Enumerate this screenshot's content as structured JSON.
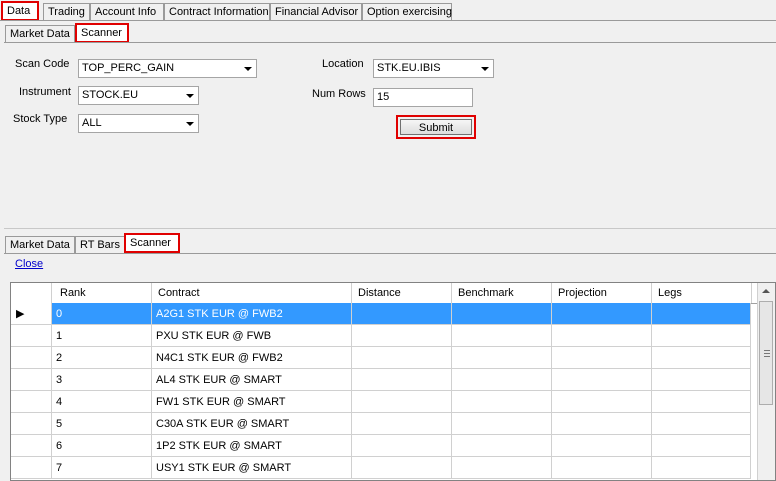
{
  "top_tabs": [
    "Data",
    "Trading",
    "Account Info",
    "Contract Information",
    "Financial Advisor",
    "Option exercising"
  ],
  "sub_tabs": [
    "Market Data",
    "Scanner"
  ],
  "form": {
    "scan_code_label": "Scan Code",
    "scan_code_value": "TOP_PERC_GAIN",
    "instrument_label": "Instrument",
    "instrument_value": "STOCK.EU",
    "stock_type_label": "Stock Type",
    "stock_type_value": "ALL",
    "location_label": "Location",
    "location_value": "STK.EU.IBIS",
    "num_rows_label": "Num Rows",
    "num_rows_value": "15",
    "submit_label": "Submit"
  },
  "result_tabs": [
    "Market Data",
    "RT Bars",
    "Scanner"
  ],
  "close_label": "Close",
  "grid": {
    "columns": [
      "Rank",
      "Contract",
      "Distance",
      "Benchmark",
      "Projection",
      "Legs"
    ],
    "rows": [
      {
        "rank": "0",
        "contract": "A2G1 STK EUR @ FWB2"
      },
      {
        "rank": "1",
        "contract": "PXU STK EUR @ FWB"
      },
      {
        "rank": "2",
        "contract": "N4C1 STK EUR @ FWB2"
      },
      {
        "rank": "3",
        "contract": "AL4 STK EUR @ SMART"
      },
      {
        "rank": "4",
        "contract": "FW1 STK EUR @ SMART"
      },
      {
        "rank": "5",
        "contract": "C30A STK EUR @ SMART"
      },
      {
        "rank": "6",
        "contract": "1P2 STK EUR @ SMART"
      },
      {
        "rank": "7",
        "contract": "USY1 STK EUR @ SMART"
      }
    ]
  },
  "colors": {
    "highlight": "#e00000",
    "selection": "#3399ff",
    "link": "#0000cc"
  }
}
